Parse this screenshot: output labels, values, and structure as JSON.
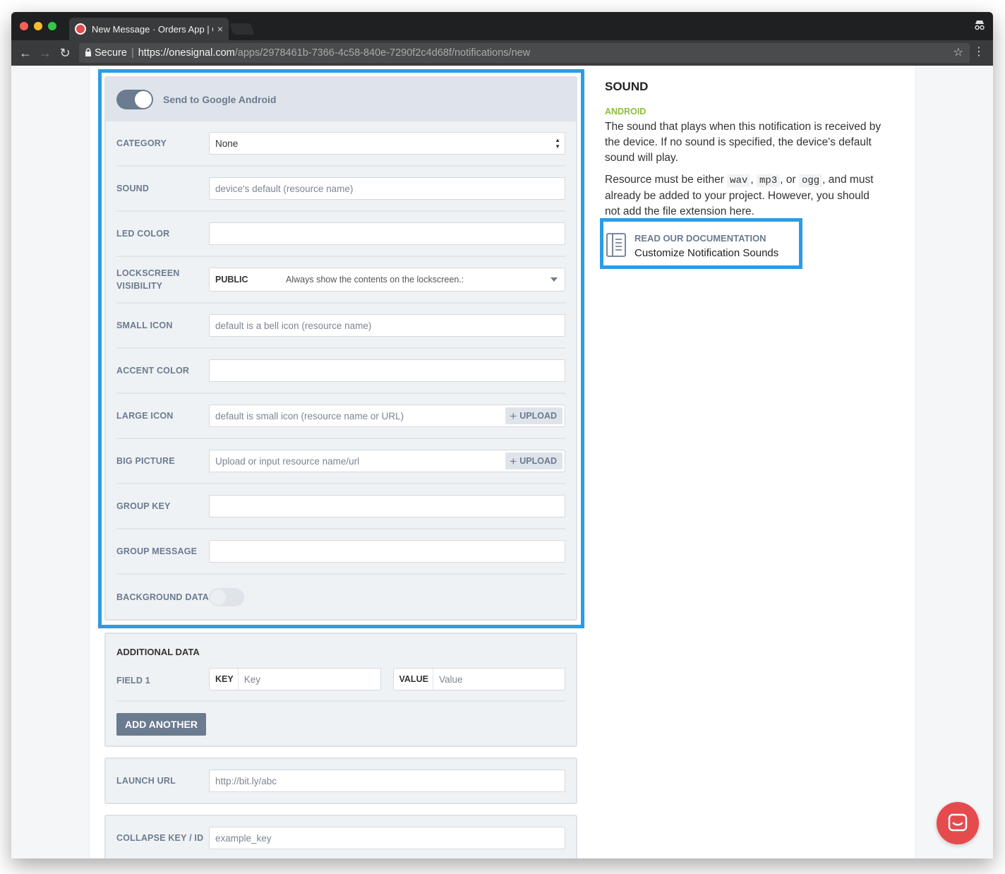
{
  "browser": {
    "tab_title": "New Message · Orders App | O",
    "tab_close": "×",
    "secure_label": "Secure",
    "url_host": "https://onesignal.com",
    "url_path": "/apps/2978461b-7366-4c58-840e-7290f2c4d68f/notifications/new"
  },
  "android": {
    "header_label": "Send to Google Android",
    "toggle_on": true,
    "rows": {
      "category": {
        "label": "CATEGORY",
        "value": "None"
      },
      "sound": {
        "label": "SOUND",
        "placeholder": "device's default (resource name)"
      },
      "led_color": {
        "label": "LED COLOR",
        "placeholder": ""
      },
      "lockscreen": {
        "label_line1": "LOCKSCREEN",
        "label_line2": "VISIBILITY",
        "value": "PUBLIC",
        "description": "Always show the contents on the lockscreen.:"
      },
      "small_icon": {
        "label": "SMALL ICON",
        "placeholder": "default is a bell icon (resource name)"
      },
      "accent_color": {
        "label": "ACCENT COLOR",
        "placeholder": ""
      },
      "large_icon": {
        "label": "LARGE ICON",
        "placeholder": "default is small icon (resource name or URL)",
        "button": "UPLOAD"
      },
      "big_picture": {
        "label": "BIG PICTURE",
        "placeholder": "Upload or input resource name/url",
        "button": "UPLOAD"
      },
      "group_key": {
        "label": "GROUP KEY",
        "placeholder": ""
      },
      "group_message": {
        "label": "GROUP MESSAGE",
        "placeholder": ""
      },
      "background_data": {
        "label": "BACKGROUND DATA",
        "toggle_on": false
      }
    }
  },
  "additional_data": {
    "title": "ADDITIONAL DATA",
    "field_label": "FIELD 1",
    "key_label": "KEY",
    "key_placeholder": "Key",
    "value_label": "VALUE",
    "value_placeholder": "Value",
    "add_button": "ADD ANOTHER"
  },
  "launch_url": {
    "label": "LAUNCH URL",
    "placeholder": "http://bit.ly/abc"
  },
  "collapse_key": {
    "label": "COLLAPSE KEY / ID",
    "placeholder": "example_key"
  },
  "help": {
    "title": "SOUND",
    "platform": "ANDROID",
    "para1": "The sound that plays when this notification is received by the device. If no sound is specified, the device's default sound will play.",
    "para2_prefix": "Resource must be either ",
    "code1": "wav",
    "code2": "mp3",
    "sep1": ", ",
    "sep2": ", or ",
    "code3": "ogg",
    "para2_suffix": ", and must already be added to your project. However, you should not add the file extension here.",
    "doc_heading": "READ OUR DOCUMENTATION",
    "doc_link": "Customize Notification Sounds"
  },
  "colors": {
    "highlight": "#2a9de4",
    "accent": "#6b7b90",
    "android_green": "#8bbf3c",
    "chat_red": "#e54b4d"
  },
  "icons": [
    "back-arrow-icon",
    "forward-arrow-icon",
    "reload-icon",
    "lock-icon",
    "star-icon",
    "menu-icon",
    "incognito-icon",
    "plus-icon",
    "document-icon",
    "chat-icon"
  ]
}
